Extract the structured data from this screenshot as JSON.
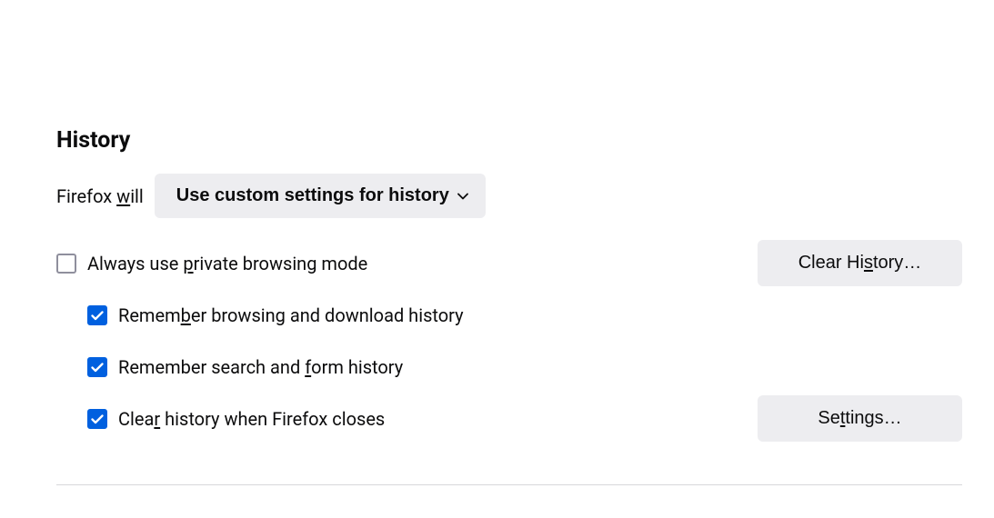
{
  "section": {
    "title": "History"
  },
  "dropdown": {
    "label_pre": "Firefox ",
    "label_ul": "w",
    "label_post": "ill",
    "selected": "Use custom settings for history"
  },
  "checkboxes": {
    "private_mode": {
      "checked": false,
      "label_pre": "Always use ",
      "label_ul": "p",
      "label_post": "rivate browsing mode"
    },
    "remember_browsing": {
      "checked": true,
      "label_pre": "Remem",
      "label_ul": "b",
      "label_post": "er browsing and download history"
    },
    "remember_search": {
      "checked": true,
      "label_pre": "Remember search and ",
      "label_ul": "f",
      "label_post": "orm history"
    },
    "clear_on_close": {
      "checked": true,
      "label_pre": "Clea",
      "label_ul": "r",
      "label_post": " history when Firefox closes"
    }
  },
  "buttons": {
    "clear_history_pre": "Clear Hi",
    "clear_history_ul": "s",
    "clear_history_post": "tory…",
    "settings_pre": "Se",
    "settings_ul": "t",
    "settings_post": "tings…"
  }
}
